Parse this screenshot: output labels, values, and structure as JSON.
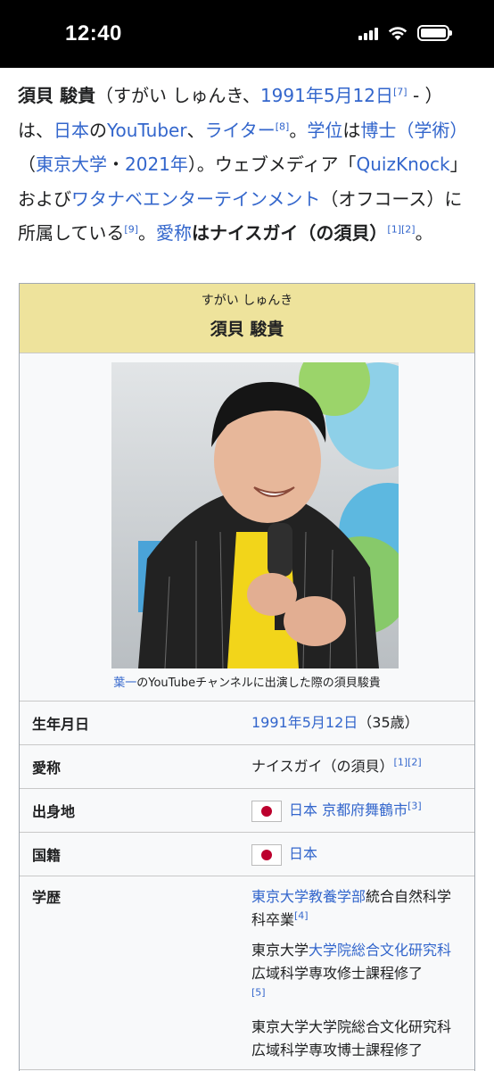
{
  "status_bar": {
    "time": "12:40"
  },
  "intro": {
    "name": "須貝 駿貴",
    "t1": "（すがい しゅんき、",
    "birth_link": "1991年5月12日",
    "ref7": "[7]",
    "t2": " - ）は、",
    "japan_link": "日本",
    "t3": "の",
    "youtuber_link": "YouTuber",
    "t4": "、",
    "writer_link": "ライター",
    "ref8": "[8]",
    "t5": "。",
    "degree_link": "学位",
    "t6": "は",
    "phd_link": "博士（学術）",
    "t7": "（",
    "utokyo_link": "東京大学",
    "t8": "・",
    "year_link": "2021年",
    "t9": "）。ウェブメディア「",
    "quizknock_link": "QuizKnock",
    "t10": "」および",
    "watanabe_link": "ワタナベエンターテインメント",
    "t11": "（オフコース）に所属している",
    "ref9": "[9]",
    "t12": "。",
    "nickname_link": "愛称",
    "t13": "は",
    "nickname": "ナイスガイ（の須貝）",
    "ref12": "[1][2]",
    "t14": "。"
  },
  "infobox": {
    "ruby": "すがい しゅんき",
    "name": "須貝 駿貴",
    "photo_alt": "須貝駿貴の写真",
    "caption_link": "葉一",
    "caption_text": "のYouTubeチャンネルに出演した際の須貝駿貴",
    "rows": {
      "birth": {
        "label": "生年月日",
        "date": "1991年5月12日",
        "age": "（35歳）"
      },
      "nickname": {
        "label": "愛称",
        "value": "ナイスガイ（の須貝）",
        "ref": "[1][2]"
      },
      "birthplace": {
        "label": "出身地",
        "country": "日本",
        "city": "京都府舞鶴市",
        "ref": "[3]"
      },
      "nationality": {
        "label": "国籍",
        "country": "日本"
      },
      "education": {
        "label": "学歴",
        "e1_link": "東京大学教養学部",
        "e1_text": "統合自然科学科卒業",
        "e1_ref": "[4]",
        "e2_text_a": "東京大学",
        "e2_link": "大学院総合文化研究科",
        "e2_text_b": "広域科学専攻修士課程修了",
        "e2_ref": "[5]",
        "e3_text": "東京大学大学院総合文化研究科広域科学専攻博士課程修了"
      }
    }
  }
}
